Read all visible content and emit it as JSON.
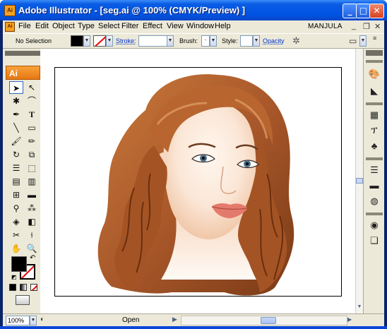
{
  "window": {
    "title": "Adobe Illustrator - [seg.ai @ 100% (CMYK/Preview) ]",
    "app_icon": "Ai"
  },
  "menu": {
    "items": [
      "File",
      "Edit",
      "Object",
      "Type",
      "Select",
      "Filter",
      "Effect",
      "View",
      "Window",
      "Help"
    ],
    "user": "MANJULA"
  },
  "controlbar": {
    "selection": "No Selection",
    "stroke_label": "Stroke:",
    "brush_label": "Brush:",
    "brush_value": "·",
    "style_label": "Style:",
    "opacity_label": "Opacity"
  },
  "toolbox": {
    "logo": "Ai"
  },
  "status": {
    "zoom": "100%",
    "text": "Open"
  },
  "colors": {
    "title_blue": "#0054e3",
    "chrome": "#ece9d8",
    "hair": "#8c4a1c",
    "lips": "#e47a6c",
    "ai_orange": "#f08a24"
  }
}
